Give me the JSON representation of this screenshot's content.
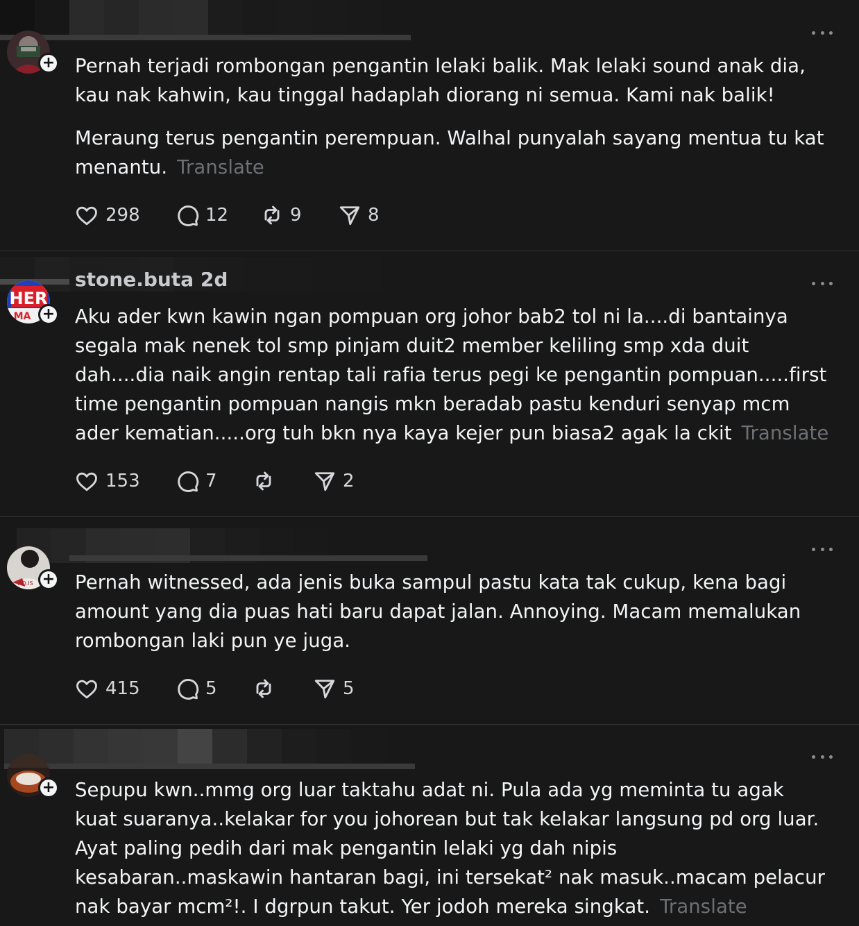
{
  "posts": [
    {
      "paragraphs": [
        "Pernah terjadi rombongan pengantin lelaki balik. Mak lelaki sound anak dia, kau nak kahwin, kau tinggal hadaplah diorang ni semua. Kami nak balik!",
        "Meraung terus pengantin perempuan. Walhal punyalah sayang mentua tu kat menantu."
      ],
      "translate": "Translate",
      "likes": "298",
      "replies": "12",
      "reposts": "9",
      "shares": "8"
    },
    {
      "header_text": "stone.buta  2d",
      "avatar_text": "HER MA",
      "paragraphs": [
        "Aku ader kwn kawin ngan pompuan org johor bab2 tol ni la....di bantainya segala mak nenek tol smp pinjam duit2 member keliling smp xda duit dah....dia naik angin rentap tali rafia terus pegi ke pengantin pompuan.....first time pengantin pompuan nangis mkn beradab pastu kenduri senyap mcm ader kematian.....org tuh bkn nya kaya kejer pun biasa2 agak la ckit"
      ],
      "translate": "Translate",
      "likes": "153",
      "replies": "7",
      "reposts": "",
      "shares": "2"
    },
    {
      "paragraphs": [
        "Pernah witnessed, ada jenis buka sampul pastu kata tak cukup, kena bagi amount yang dia puas hati baru dapat jalan. Annoying. Macam memalukan rombongan laki pun ye juga."
      ],
      "translate": "",
      "likes": "415",
      "replies": "5",
      "reposts": "",
      "shares": "5"
    },
    {
      "paragraphs": [
        "Sepupu kwn..mmg org luar taktahu adat ni. Pula ada yg meminta tu agak kuat suaranya..kelakar for you johorean but tak kelakar langsung pd org luar. Ayat paling pedih dari mak pengantin lelaki yg dah nipis kesabaran..maskawin hantaran bagi, ini tersekat² nak masuk..macam pelacur nak bayar mcm²!. I dgrpun takut. Yer jodoh mereka singkat."
      ],
      "translate": "Translate"
    }
  ],
  "icons": {
    "like": "heart-outline-icon",
    "reply": "speech-bubble-icon",
    "repost": "repost-arrows-icon",
    "share": "paper-plane-icon",
    "more": "more-dots-icon",
    "follow": "plus-icon"
  },
  "colors": {
    "background": "#181818",
    "text": "#f3f5f7",
    "muted": "#6d7074",
    "divider": "#333638"
  }
}
